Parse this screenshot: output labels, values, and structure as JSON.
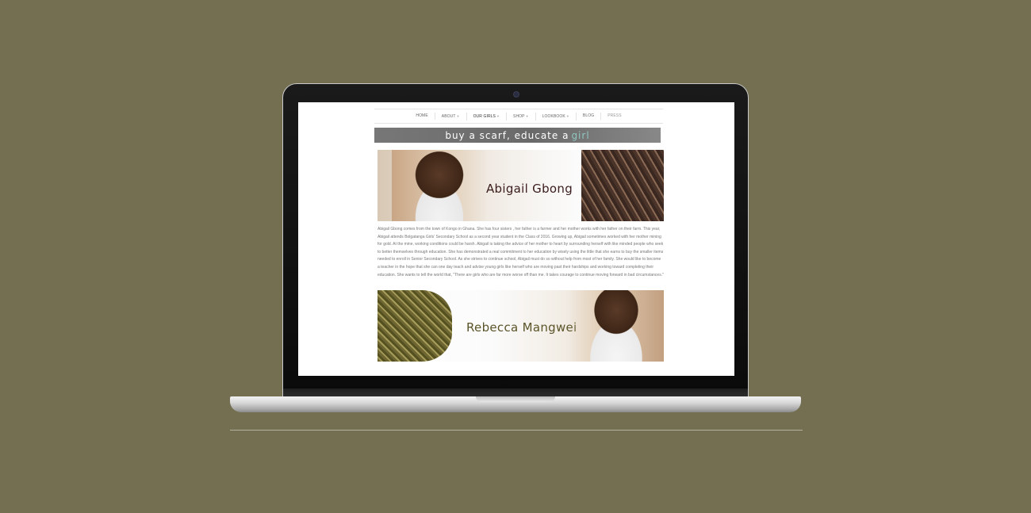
{
  "nav": {
    "items": [
      {
        "label": "HOME",
        "dropdown": false
      },
      {
        "label": "ABOUT",
        "dropdown": true
      },
      {
        "label": "OUR GIRLS",
        "dropdown": true
      },
      {
        "label": "SHOP",
        "dropdown": true
      },
      {
        "label": "LOOKBOOK",
        "dropdown": true
      },
      {
        "label": "BLOG",
        "dropdown": false
      },
      {
        "label": "PRESS",
        "dropdown": false
      }
    ]
  },
  "banner": {
    "text": "buy a scarf, educate a",
    "accent": "girl"
  },
  "profiles": [
    {
      "name": "Abigail Gbong",
      "name_color": "#3a1c1c",
      "bio": "Abigail Gbong comes from the town of Kongo in Ghana. She has four sisters , her father is a farmer and her mother works with her father on their farm. This year, Abigail attends Bolgatanga Girls' Secondary School as a second year student in the Class of 2016. Growing up, Abigail sometimes worked with her mother mining for gold. At the mine, working conditions could be harsh. Abigail is taking the advice of her mother to heart by surrounding herself with like minded people who seek to better themselves through education. She has demonstrated a real commitment to her education by wisely using the little that she earns to buy the smaller items needed to enroll in Senior Secondary School. As she strives to continue school, Abigail must do so without help from most of her family. She would like to become a teacher in the hope that she can one day teach and advise young girls like herself who are moving past their hardships and working toward completing their education. She wants to tell the world that, \"There are girls who are far more worse off than me. It takes courage to continue moving forward in bad circumstances.\""
    },
    {
      "name": "Rebecca Mangwei",
      "name_color": "#5a5428"
    }
  ],
  "colors": {
    "background": "#736f50",
    "banner_accent": "#8fc6bf"
  }
}
